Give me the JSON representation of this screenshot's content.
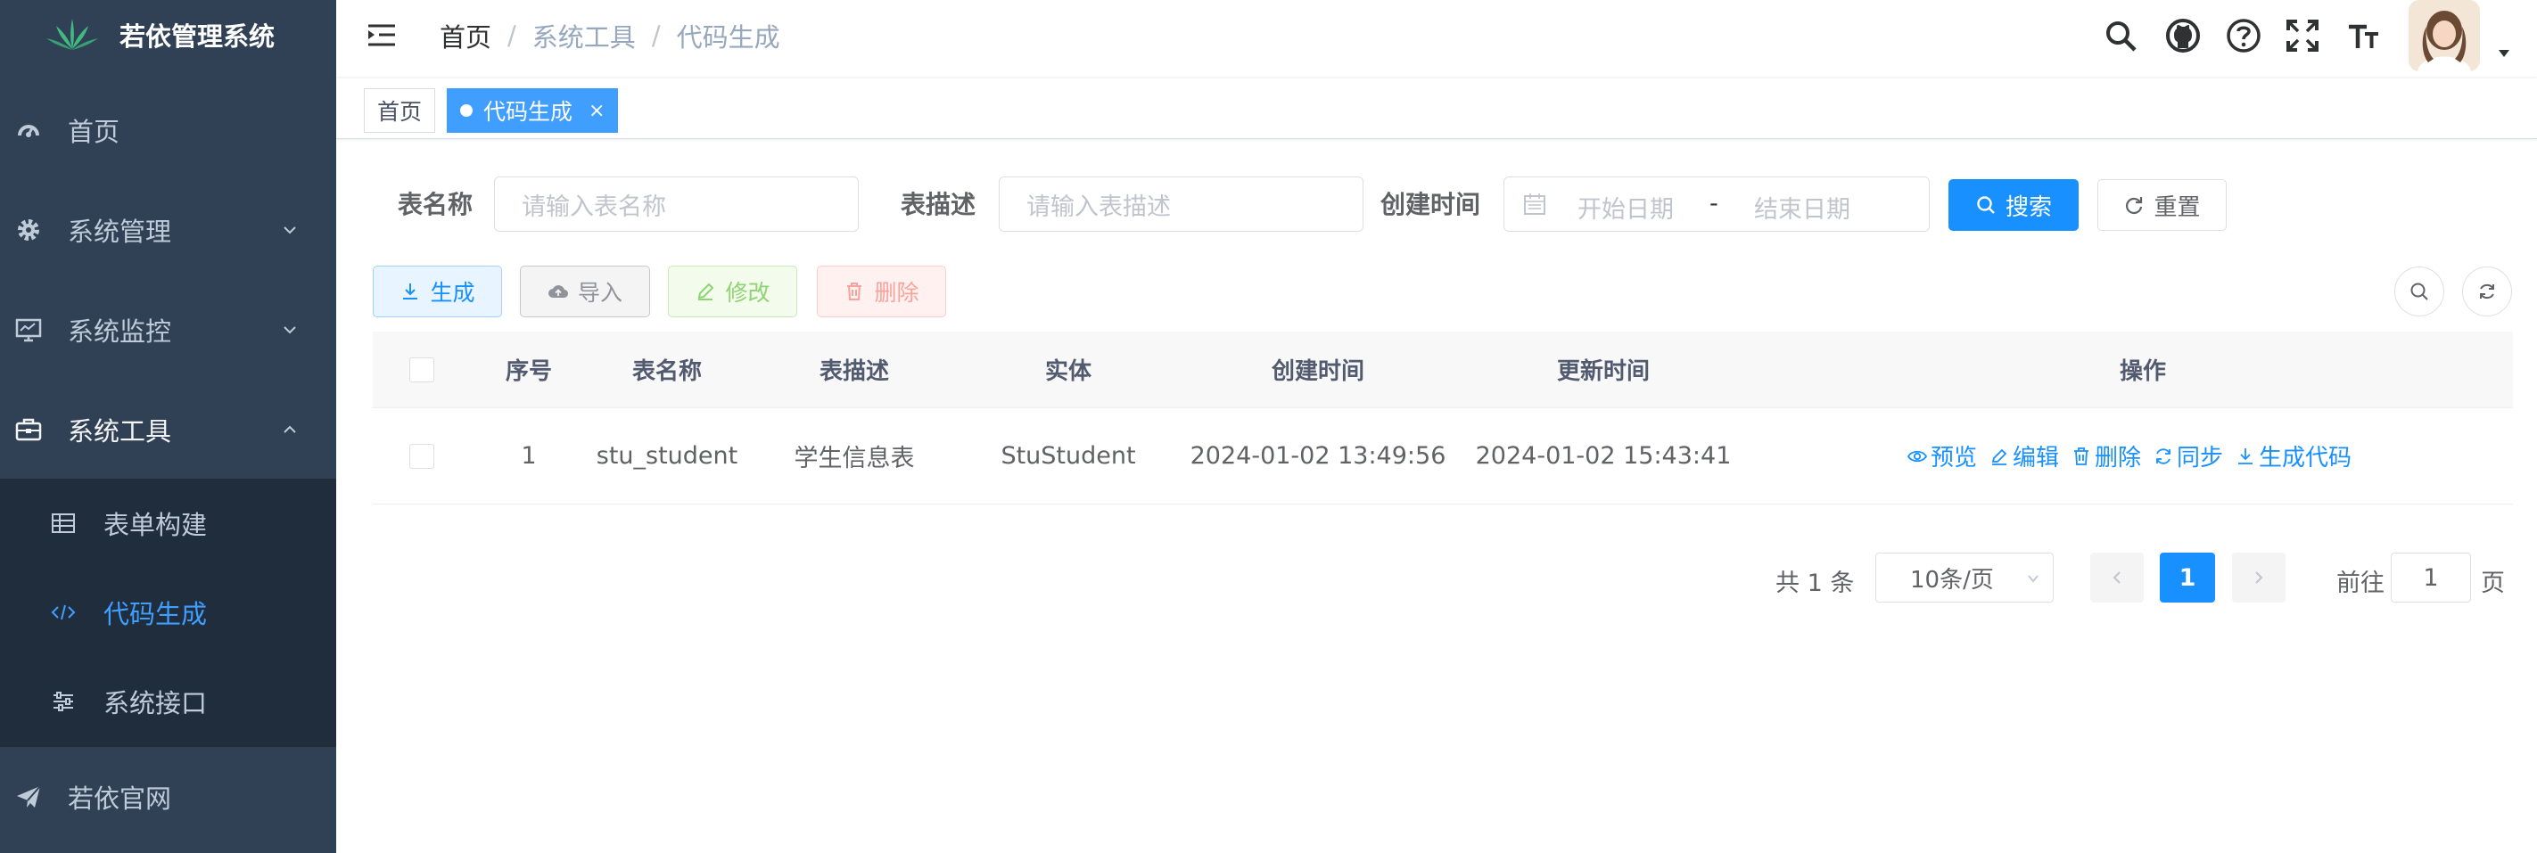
{
  "app": {
    "title": "若依管理系统"
  },
  "sidebar": {
    "items": [
      {
        "label": "首页",
        "icon": "dashboard-icon"
      },
      {
        "label": "系统管理",
        "icon": "gear-icon"
      },
      {
        "label": "系统监控",
        "icon": "monitor-icon"
      },
      {
        "label": "系统工具",
        "icon": "toolbox-icon"
      },
      {
        "label": "若依官网",
        "icon": "paper-plane-icon"
      }
    ],
    "tool_children": [
      {
        "label": "表单构建",
        "icon": "grid-icon"
      },
      {
        "label": "代码生成",
        "icon": "code-icon",
        "active": true
      },
      {
        "label": "系统接口",
        "icon": "sliders-icon"
      }
    ]
  },
  "navbar": {
    "breadcrumb": [
      "首页",
      "系统工具",
      "代码生成"
    ]
  },
  "tags": {
    "home": "首页",
    "current": "代码生成",
    "close": "×"
  },
  "search": {
    "table_name_label": "表名称",
    "table_name_placeholder": "请输入表名称",
    "table_desc_label": "表描述",
    "table_desc_placeholder": "请输入表描述",
    "create_time_label": "创建时间",
    "start_placeholder": "开始日期",
    "range_separator": "-",
    "end_placeholder": "结束日期",
    "search_button": "搜索",
    "reset_button": "重置"
  },
  "toolbar": {
    "generate": "生成",
    "import": "导入",
    "edit": "修改",
    "delete": "删除"
  },
  "table": {
    "headers": {
      "index": "序号",
      "table_name": "表名称",
      "table_desc": "表描述",
      "entity": "实体",
      "create_time": "创建时间",
      "update_time": "更新时间",
      "actions": "操作"
    },
    "rows": [
      {
        "index": "1",
        "table_name": "stu_student",
        "table_desc": "学生信息表",
        "entity": "StuStudent",
        "create_time": "2024-01-02 13:49:56",
        "update_time": "2024-01-02 15:43:41"
      }
    ],
    "row_actions": {
      "preview": "预览",
      "edit": "编辑",
      "delete": "删除",
      "sync": "同步",
      "generate": "生成代码"
    }
  },
  "pagination": {
    "total": "共 1 条",
    "page_size": "10条/页",
    "current_page": "1",
    "goto_prefix": "前往",
    "goto_value": "1",
    "goto_suffix": "页"
  },
  "colors": {
    "sidebar_bg": "#304156",
    "submenu_bg": "#1f2d3d",
    "primary": "#1890ff",
    "active_menu": "#409eff"
  }
}
